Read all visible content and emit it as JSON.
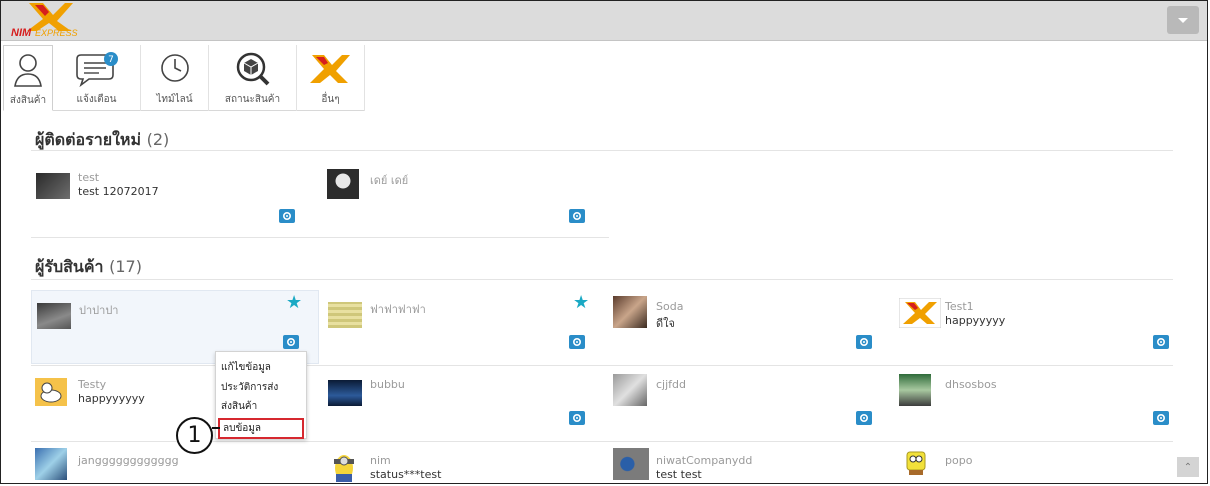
{
  "header": {
    "logo_text": "NIM EXPRESS",
    "menu_button_icon": "chevron-down-icon"
  },
  "tabs": [
    {
      "label": "ส่งสินค้า",
      "icon": "user-icon"
    },
    {
      "label": "แจ้งเตือน",
      "icon": "chat-icon",
      "badge": "7"
    },
    {
      "label": "ไทม์ไลน์",
      "icon": "clock-icon"
    },
    {
      "label": "สถานะสินค้า",
      "icon": "box-search-icon"
    },
    {
      "label": "อื่นๆ",
      "icon": "nim-logo-icon"
    }
  ],
  "new_contacts": {
    "title": "ผู้ติดต่อรายใหม่",
    "count": "(2)",
    "items": [
      {
        "name": "test",
        "status": "test 12072017"
      },
      {
        "name": "เดย์ เดย์",
        "status": ""
      }
    ]
  },
  "receivers": {
    "title": "ผู้รับสินค้า",
    "count": "(17)",
    "items": [
      {
        "name": "ปาปาปา",
        "status": "",
        "starred": true
      },
      {
        "name": "ฟาฟาฟาฟา",
        "status": "",
        "starred": true
      },
      {
        "name": "Soda",
        "status": "ดีใจ"
      },
      {
        "name": "Test1",
        "status": "happyyyyy"
      },
      {
        "name": "Testy",
        "status": "happyyyyyy"
      },
      {
        "name": "bubbu",
        "status": ""
      },
      {
        "name": "cjjfdd",
        "status": ""
      },
      {
        "name": "dhsosbos",
        "status": ""
      },
      {
        "name": "jangggggggggggg",
        "status": ""
      },
      {
        "name": "nim",
        "status": "status***test"
      },
      {
        "name": "niwatCompanydd",
        "status": "test test"
      },
      {
        "name": "popo",
        "status": ""
      }
    ]
  },
  "context_menu": {
    "items": [
      "แก้ไขข้อมูล",
      "ประวัติการส่ง",
      "ส่งสินค้า",
      "ลบข้อมูล"
    ]
  },
  "annotation": {
    "step": "1"
  },
  "colors": {
    "accent": "#2a8dc8",
    "star": "#1aa9c4",
    "highlight": "#d6282f"
  }
}
